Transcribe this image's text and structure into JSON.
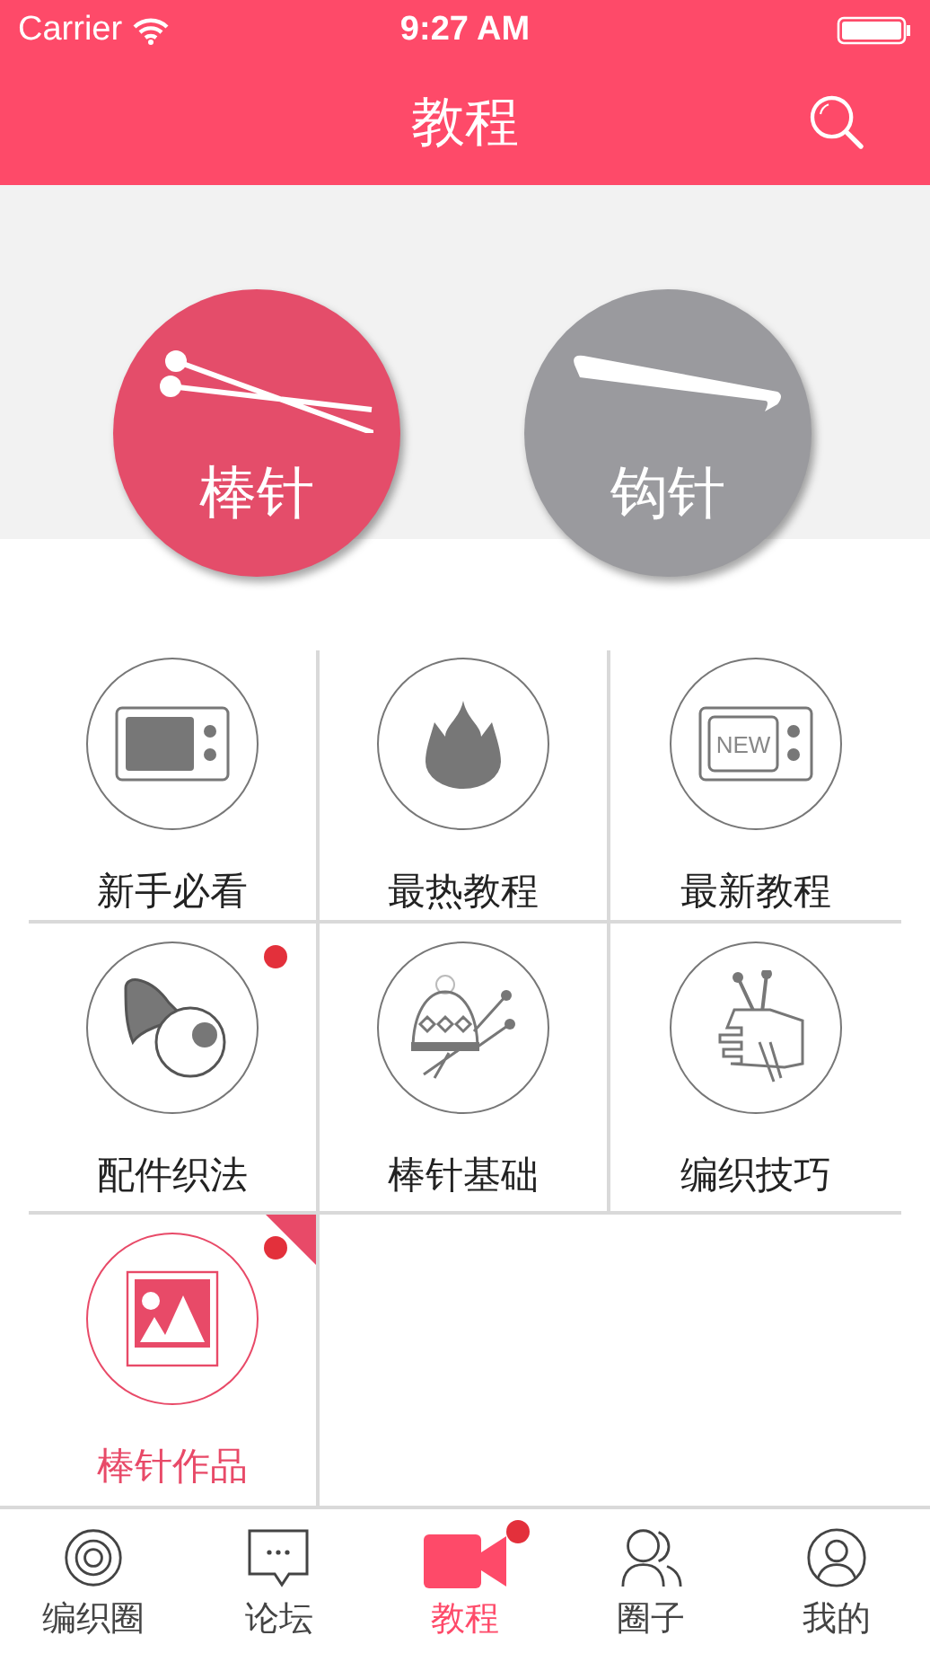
{
  "status_bar": {
    "carrier": "Carrier",
    "time": "9:27 AM"
  },
  "nav_bar": {
    "title": "教程"
  },
  "categories": [
    {
      "label": "棒针",
      "kind": "knitting",
      "selected": true
    },
    {
      "label": "钩针",
      "kind": "crochet",
      "selected": false
    }
  ],
  "grid": [
    {
      "label": "新手必看",
      "kind": "tv",
      "badge": false,
      "selected": false
    },
    {
      "label": "最热教程",
      "kind": "flame",
      "badge": false,
      "selected": false
    },
    {
      "label": "最新教程",
      "kind": "new-tv",
      "icon_text": "NEW",
      "badge": false,
      "selected": false
    },
    {
      "label": "配件织法",
      "kind": "accessory",
      "badge": true,
      "selected": false
    },
    {
      "label": "棒针基础",
      "kind": "hat",
      "badge": false,
      "selected": false
    },
    {
      "label": "编织技巧",
      "kind": "hand",
      "badge": false,
      "selected": false
    },
    {
      "label": "棒针作品",
      "kind": "picture",
      "badge": true,
      "selected": true
    }
  ],
  "tab_bar": [
    {
      "label": "编织圈",
      "kind": "rings",
      "selected": false,
      "badge": false
    },
    {
      "label": "论坛",
      "kind": "chat",
      "selected": false,
      "badge": false
    },
    {
      "label": "教程",
      "kind": "video",
      "selected": true,
      "badge": true
    },
    {
      "label": "圈子",
      "kind": "people",
      "selected": false,
      "badge": false
    },
    {
      "label": "我的",
      "kind": "person",
      "selected": false,
      "badge": false
    }
  ]
}
